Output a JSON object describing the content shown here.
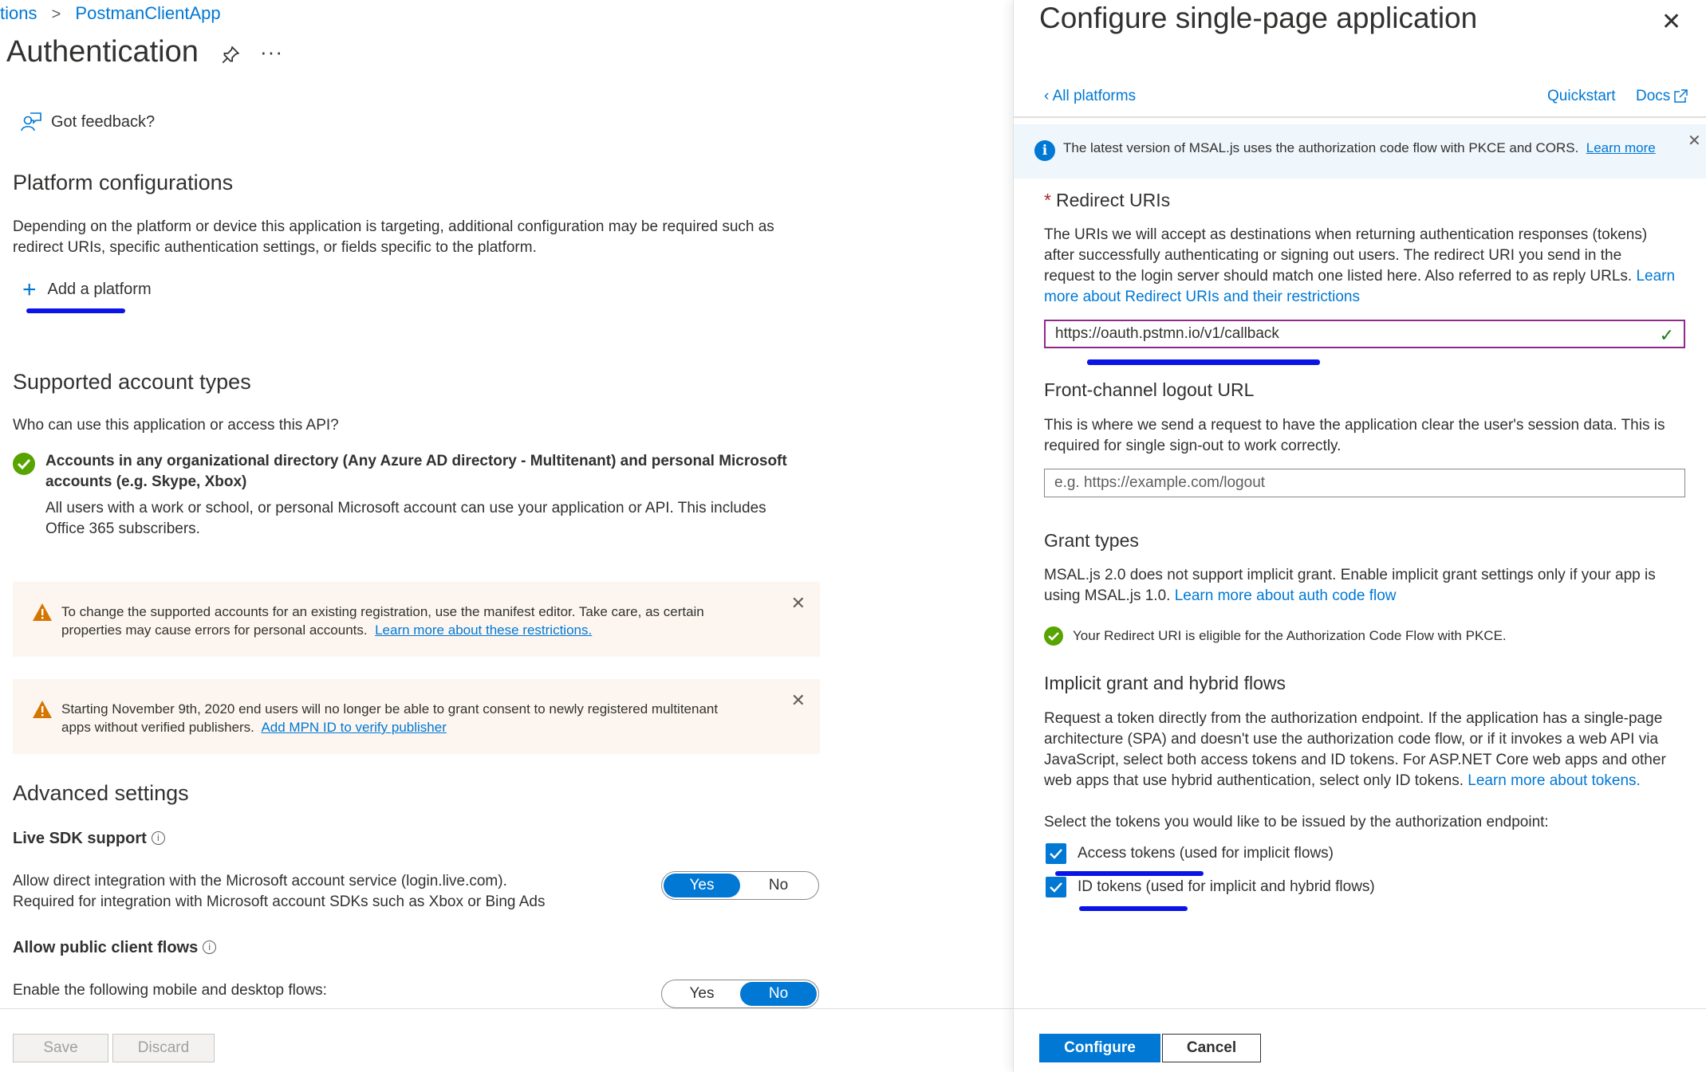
{
  "breadcrumb": {
    "parent": "tions",
    "current": "PostmanClientApp"
  },
  "page": {
    "title": "Authentication",
    "more": "···"
  },
  "feedback": {
    "label": "Got feedback?"
  },
  "platform_configurations": {
    "heading": "Platform configurations",
    "description_line1": "Depending on the platform or device this application is targeting, additional configuration may be required such as",
    "description_line2": "redirect URIs, specific authentication settings, or fields specific to the platform.",
    "add_platform_label": "Add a platform"
  },
  "supported_accounts": {
    "heading": "Supported account types",
    "question": "Who can use this application or access this API?",
    "selected_title_line1": "Accounts in any organizational directory (Any Azure AD directory - Multitenant) and personal Microsoft",
    "selected_title_line2": "accounts (e.g. Skype, Xbox)",
    "selected_desc_line1": "All users with a work or school, or personal Microsoft account can use your application or API. This includes",
    "selected_desc_line2": "Office 365 subscribers."
  },
  "warnings": [
    {
      "line1": "To change the supported accounts for an existing registration, use the manifest editor. Take care, as certain",
      "line2": "properties may cause errors for personal accounts.",
      "link": "Learn more about these restrictions."
    },
    {
      "line1": "Starting November 9th, 2020 end users will no longer be able to grant consent to newly registered multitenant",
      "line2": "apps without verified publishers.",
      "link": "Add MPN ID to verify publisher"
    }
  ],
  "advanced": {
    "heading": "Advanced settings",
    "live_sdk": {
      "label": "Live SDK support",
      "desc_line1": "Allow direct integration with the Microsoft account service (login.live.com).",
      "desc_line2": "Required for integration with Microsoft account SDKs such as Xbox or Bing Ads",
      "yes": "Yes",
      "no": "No",
      "selected": "Yes"
    },
    "public_client": {
      "label": "Allow public client flows",
      "desc": "Enable the following mobile and desktop flows:",
      "yes": "Yes",
      "no": "No",
      "selected": "No"
    }
  },
  "left_footer": {
    "save": "Save",
    "discard": "Discard"
  },
  "panel": {
    "title": "Configure single-page application",
    "all_platforms": "All platforms",
    "quickstart": "Quickstart",
    "docs": "Docs",
    "msal_notice": "The latest version of MSAL.js uses the authorization code flow with PKCE and CORS.",
    "msal_link": "Learn more",
    "redirect": {
      "heading": "Redirect URIs",
      "desc_line1": "The URIs we will accept as destinations when returning authentication responses (tokens)",
      "desc_line2": "after successfully authenticating or signing out users. The redirect URI you send in the",
      "desc_line3": "request to the login server should match one listed here. Also referred to as reply URLs.",
      "link_part1": "Learn",
      "link_part2": "more about Redirect URIs and their restrictions",
      "value": "https://oauth.pstmn.io/v1/callback"
    },
    "logout": {
      "heading": "Front-channel logout URL",
      "desc_line1": "This is where we send a request to have the application clear the user's session data. This is",
      "desc_line2": "required for single sign-out to work correctly.",
      "placeholder": "e.g. https://example.com/logout"
    },
    "grant": {
      "heading": "Grant types",
      "desc_line1": "MSAL.js 2.0 does not support implicit grant. Enable implicit grant settings only if your app is",
      "desc_line2_prefix": "using MSAL.js 1.0.",
      "desc_link": "Learn more about auth code flow",
      "eligible": "Your Redirect URI is eligible for the Authorization Code Flow with PKCE."
    },
    "implicit": {
      "heading": "Implicit grant and hybrid flows",
      "desc_line1": "Request a token directly from the authorization endpoint. If the application has a single-page",
      "desc_line2": "architecture (SPA) and doesn't use the authorization code flow, or if it invokes a web API via",
      "desc_line3": "JavaScript, select both access tokens and ID tokens. For ASP.NET Core web apps and other",
      "desc_line4_prefix": "web apps that use hybrid authentication, select only ID tokens.",
      "desc_link": "Learn more about tokens.",
      "select_prompt": "Select the tokens you would like to be issued by the authorization endpoint:",
      "access_tokens": {
        "label": "Access tokens (used for implicit flows)",
        "checked": true
      },
      "id_tokens": {
        "label": "ID tokens (used for implicit and hybrid flows)",
        "checked": true
      }
    },
    "configure": "Configure",
    "cancel": "Cancel"
  },
  "colors": {
    "accent": "#0078d4",
    "success": "#57a300",
    "warning_bg": "#fdf6f0",
    "annotation_ink": "#0a14e6"
  }
}
